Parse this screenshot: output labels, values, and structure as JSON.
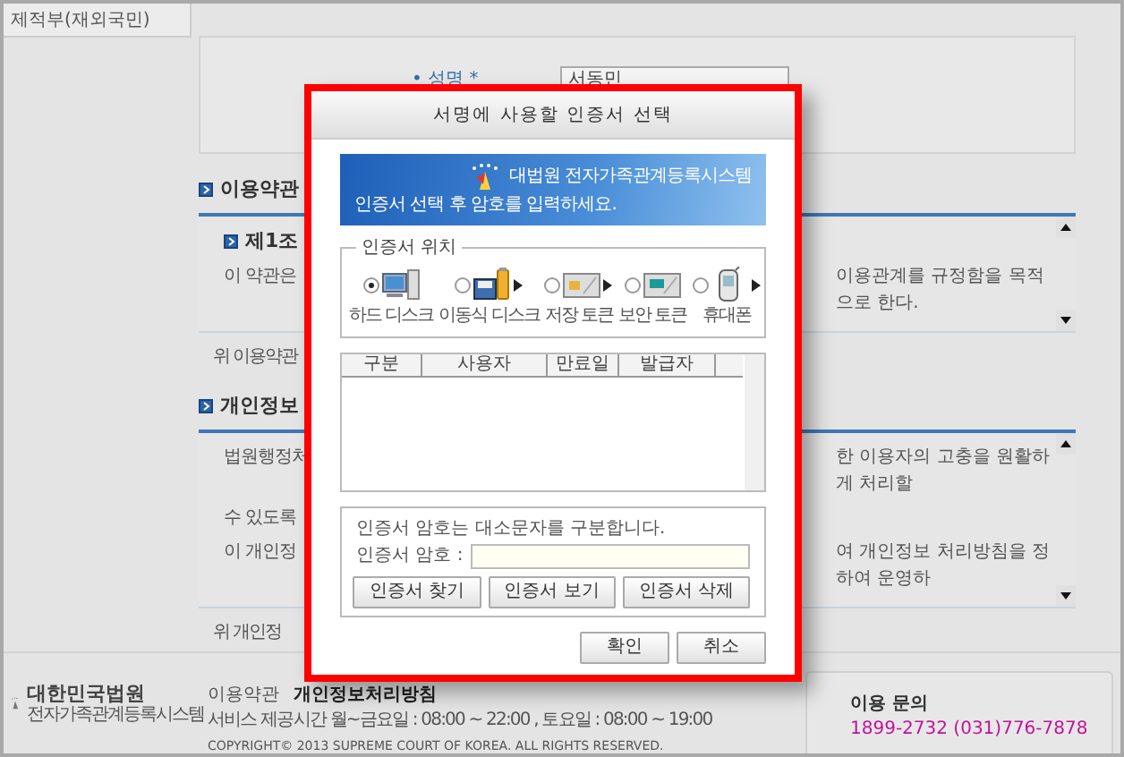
{
  "sidebar": {
    "item": "제적부(재외국민)"
  },
  "form": {
    "label": "• 성명 *",
    "value": "서동민"
  },
  "terms": {
    "heading": "이용약관",
    "article": "제1조",
    "lines": [
      {
        "left": "이 약관은",
        "right": "이용관계를 규정함을 목적으로 한다."
      }
    ],
    "note": "위 이용약관"
  },
  "privacy": {
    "heading": "개인정보",
    "lines": [
      {
        "left": "법원행정처",
        "right": "한 이용자의 고충을 원활하게 처리할"
      },
      {
        "left": "수 있도록"
      },
      {
        "left": "이 개인정",
        "right": "여 개인정보 처리방침을 정하여 운영하"
      }
    ],
    "note": "위 개인정"
  },
  "dialog": {
    "title": "서명에 사용할 인증서 선택",
    "banner": {
      "message": "인증서 선택 후 암호를 입력하세요.",
      "brand": "대법원 전자가족관계등록시스템"
    },
    "location": {
      "legend": "인증서 위치",
      "options": [
        {
          "label": "하드 디스크",
          "kind": "hdd",
          "selected": true,
          "arrow": false
        },
        {
          "label": "이동식 디스크",
          "kind": "removable",
          "selected": false,
          "arrow": true
        },
        {
          "label": "저장 토큰",
          "kind": "token",
          "selected": false,
          "arrow": true
        },
        {
          "label": "보안 토큰",
          "kind": "secure",
          "selected": false,
          "arrow": false
        },
        {
          "label": "휴대폰",
          "kind": "phone",
          "selected": false,
          "arrow": true
        }
      ]
    },
    "table": {
      "columns": [
        "구분",
        "사용자",
        "만료일",
        "발급자"
      ]
    },
    "password": {
      "hint": "인증서 암호는 대소문자를 구분합니다.",
      "label": "인증서 암호 :",
      "buttons": [
        "인증서 찾기",
        "인증서 보기",
        "인증서 삭제"
      ]
    },
    "buttons": [
      "확인",
      "취소"
    ]
  },
  "footer": {
    "logo_title": "대한민국법원",
    "logo_subtitle": "전자가족관계등록시스템",
    "links": [
      {
        "label": "이용약관",
        "bold": false
      },
      {
        "label": "개인정보처리방침",
        "bold": true
      }
    ],
    "hours": "서비스 제공시간  월~금요일 : 08:00 ~ 22:00 , 토요일 : 08:00 ~ 19:00",
    "copyright": "COPYRIGHT© 2013  SUPREME COURT OF KOREA. ALL RIGHTS  RESERVED.",
    "contact": {
      "title": "이용 문의",
      "phone": "1899-2732 (031)776-7878"
    }
  }
}
